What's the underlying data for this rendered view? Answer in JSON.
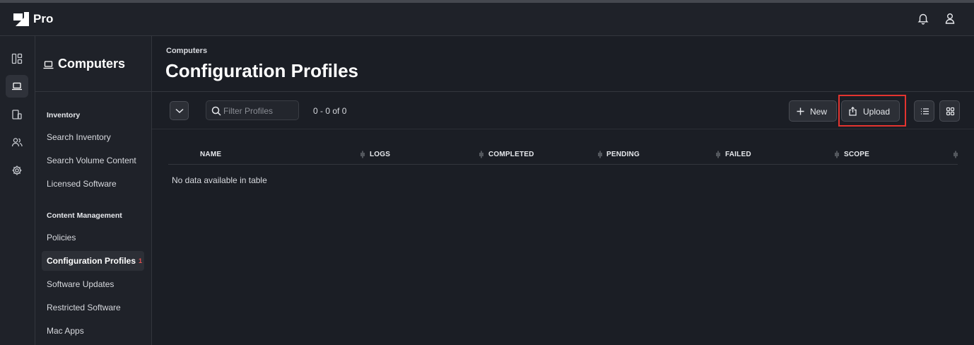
{
  "app": {
    "brand": "Pro"
  },
  "header": {
    "icons": [
      "bell-icon",
      "user-icon"
    ]
  },
  "rail": {
    "items": [
      {
        "icon": "dashboard-icon",
        "active": false
      },
      {
        "icon": "laptop-icon",
        "active": true
      },
      {
        "icon": "devices-icon",
        "active": false
      },
      {
        "icon": "users-icon",
        "active": false
      },
      {
        "icon": "gear-icon",
        "active": false
      }
    ]
  },
  "subnav": {
    "title": "Computers",
    "sections": [
      {
        "label": "Inventory",
        "items": [
          "Search Inventory",
          "Search Volume Content",
          "Licensed Software"
        ]
      },
      {
        "label": "Content Management",
        "items": [
          "Policies",
          "Configuration Profiles",
          "Software Updates",
          "Restricted Software",
          "Mac Apps"
        ]
      }
    ],
    "active_item": "Configuration Profiles",
    "active_badge": "1"
  },
  "main": {
    "breadcrumb": "Computers",
    "title": "Configuration Profiles",
    "search_placeholder": "Filter Profiles",
    "count": "0 - 0 of 0",
    "new_label": "New",
    "upload_label": "Upload",
    "table": {
      "columns": [
        "NAME",
        "LOGS",
        "COMPLETED",
        "PENDING",
        "FAILED",
        "SCOPE"
      ],
      "empty_message": "No data available in table"
    }
  },
  "colors": {
    "background": "#1b1e25",
    "panel": "#1f2229",
    "highlight": "#e3342f",
    "badge": "#e05252"
  }
}
